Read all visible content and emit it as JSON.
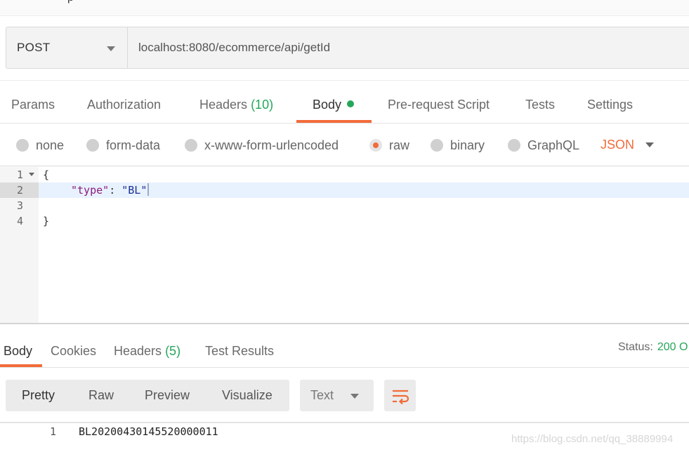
{
  "request": {
    "method": "POST",
    "url": "localhost:8080/ecommerce/api/getId"
  },
  "request_tabs": [
    {
      "label": "Params"
    },
    {
      "label": "Authorization"
    },
    {
      "label": "Headers",
      "count": "(10)"
    },
    {
      "label": "Body",
      "active": true
    },
    {
      "label": "Pre-request Script"
    },
    {
      "label": "Tests"
    },
    {
      "label": "Settings"
    }
  ],
  "body_types": [
    {
      "label": "none"
    },
    {
      "label": "form-data"
    },
    {
      "label": "x-www-form-urlencoded"
    },
    {
      "label": "raw",
      "selected": true
    },
    {
      "label": "binary"
    },
    {
      "label": "GraphQL"
    }
  ],
  "body_format": "JSON",
  "editor": {
    "lines": [
      {
        "num": "1",
        "text": "{"
      },
      {
        "num": "2",
        "key": "\"type\"",
        "sep": ": ",
        "value": "\"BL\""
      },
      {
        "num": "3",
        "text": ""
      },
      {
        "num": "4",
        "text": "}"
      }
    ]
  },
  "response_tabs": [
    {
      "label": "Body",
      "active": true
    },
    {
      "label": "Cookies"
    },
    {
      "label": "Headers",
      "count": "(5)"
    },
    {
      "label": "Test Results"
    }
  ],
  "status": {
    "label": "Status:",
    "value": "200 O"
  },
  "view_modes": [
    "Pretty",
    "Raw",
    "Preview",
    "Visualize"
  ],
  "response_format": "Text",
  "response_body": {
    "line_num": "1",
    "text": "BL20200430145520000011"
  },
  "watermark": "https://blog.csdn.net/qq_38889994",
  "colors": {
    "accent": "#f26b3a",
    "success": "#26a65b"
  },
  "icons": {
    "wrap": "wrap-lines-icon",
    "caret": "chevron-down-icon",
    "fold": "fold-arrow-icon"
  }
}
